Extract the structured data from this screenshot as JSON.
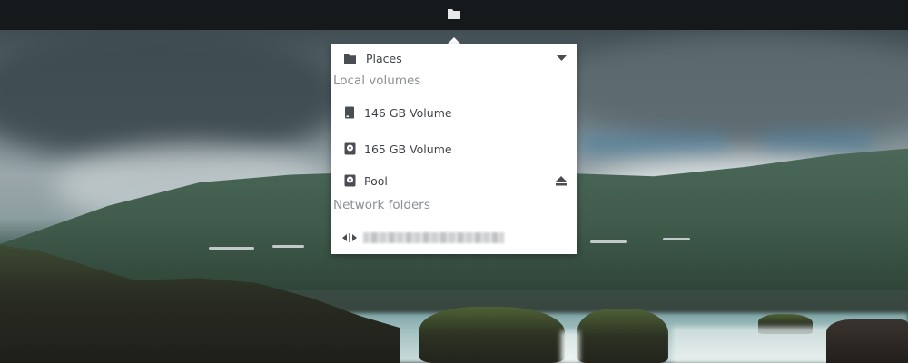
{
  "topbar": {
    "folder_icon": "folder-icon"
  },
  "menu": {
    "places": {
      "label": "Places",
      "icon": "folder-icon",
      "expander_icon": "triangle-down-icon"
    },
    "local_volumes": {
      "header": "Local volumes",
      "items": [
        {
          "label": "146 GB Volume",
          "icon": "drive-icon"
        },
        {
          "label": "165 GB Volume",
          "icon": "disk-icon"
        },
        {
          "label": "Pool",
          "icon": "disk-icon",
          "action_icon": "eject-icon"
        }
      ]
    },
    "network_folders": {
      "header": "Network folders",
      "items": [
        {
          "label": "",
          "icon": "network-icon",
          "redacted": true
        }
      ]
    }
  },
  "colors": {
    "topbar": "#16191c",
    "popover": "#ffffff",
    "text": "#404448",
    "header_text": "#8c8f93",
    "icon": "#4a4e53"
  }
}
